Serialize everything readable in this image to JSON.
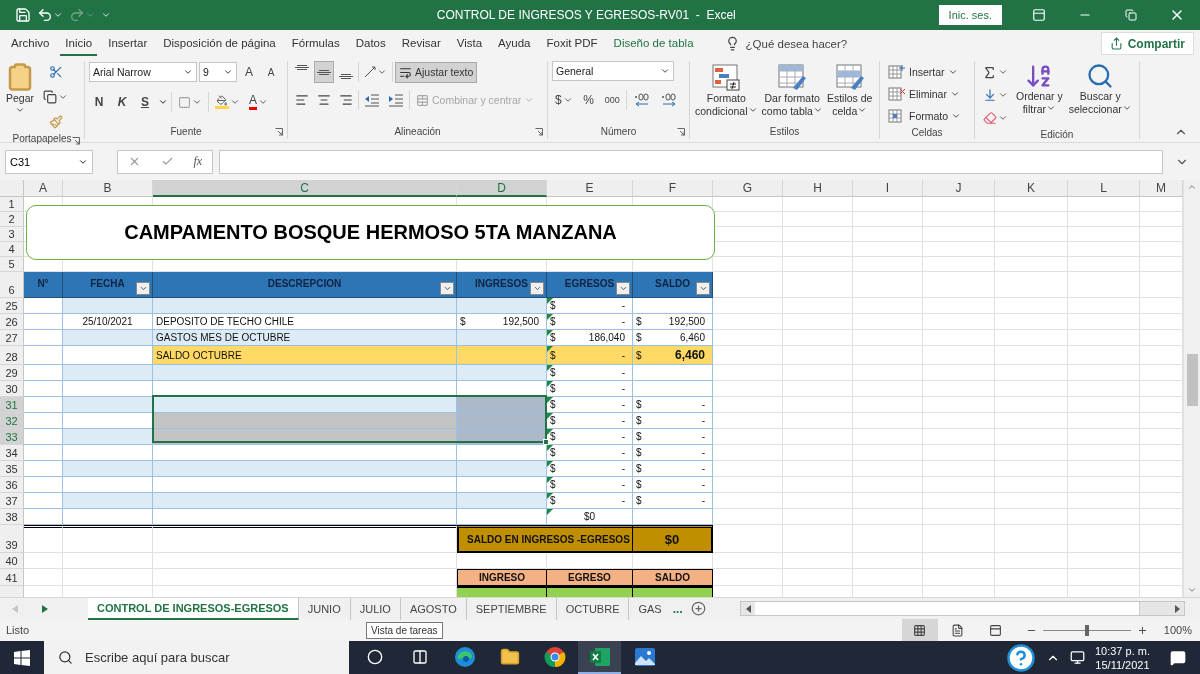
{
  "window": {
    "title": "CONTROL DE INGRESOS Y EGRESOS-RV01  -  Excel",
    "sign_in": "Inic. ses."
  },
  "menu_tabs": [
    {
      "label": "Archivo",
      "selected": false,
      "kind": "normal"
    },
    {
      "label": "Inicio",
      "selected": true,
      "kind": "normal"
    },
    {
      "label": "Insertar",
      "selected": false,
      "kind": "normal"
    },
    {
      "label": "Disposición de página",
      "selected": false,
      "kind": "normal"
    },
    {
      "label": "Fórmulas",
      "selected": false,
      "kind": "normal"
    },
    {
      "label": "Datos",
      "selected": false,
      "kind": "normal"
    },
    {
      "label": "Revisar",
      "selected": false,
      "kind": "normal"
    },
    {
      "label": "Vista",
      "selected": false,
      "kind": "normal"
    },
    {
      "label": "Ayuda",
      "selected": false,
      "kind": "normal"
    },
    {
      "label": "Foxit PDF",
      "selected": false,
      "kind": "normal"
    },
    {
      "label": "Diseño de tabla",
      "selected": false,
      "kind": "contextual"
    }
  ],
  "tell_me": "¿Qué desea hacer?",
  "share": "Compartir",
  "ribbon": {
    "clipboard": {
      "paste": "Pegar",
      "label": "Portapapeles"
    },
    "font": {
      "name": "Arial Narrow",
      "size": "9",
      "grow": "A",
      "shrink": "A",
      "bold": "N",
      "italic": "K",
      "underline": "S",
      "text_color_letter": "A",
      "label": "Fuente"
    },
    "alignment": {
      "valign": [
        {
          "selected": false
        },
        {
          "selected": true
        },
        {
          "selected": false
        }
      ],
      "wrap": {
        "label": "Ajustar texto",
        "on": true
      },
      "merge": {
        "label": "Combinar y centrar",
        "disabled": true
      },
      "label": "Alineación"
    },
    "number": {
      "format": "General",
      "currency": "$",
      "percent": "%",
      "thousands": "000",
      "label": "Número"
    },
    "styles": {
      "buttons": [
        {
          "line1": "Formato",
          "line2": "condicional"
        },
        {
          "line1": "Dar formato",
          "line2": "como tabla"
        },
        {
          "line1": "Estilos de",
          "line2": "celda"
        }
      ],
      "label": "Estilos"
    },
    "cells": {
      "items": [
        "Insertar",
        "Eliminar",
        "Formato"
      ],
      "label": "Celdas"
    },
    "editing": {
      "buttons": [
        {
          "line1": "Ordenar y",
          "line2": "filtrar"
        },
        {
          "line1": "Buscar y",
          "line2": "seleccionar"
        }
      ],
      "label": "Edición"
    }
  },
  "formula_bar": {
    "name_box": "C31",
    "fx": "fx"
  },
  "sheet": {
    "columns": [
      {
        "label": "A",
        "selected": false
      },
      {
        "label": "B",
        "selected": false
      },
      {
        "label": "C",
        "selected": true
      },
      {
        "label": "D",
        "selected": true
      },
      {
        "label": "E",
        "selected": false
      },
      {
        "label": "F",
        "selected": false
      },
      {
        "label": "G",
        "selected": false
      },
      {
        "label": "H",
        "selected": false
      },
      {
        "label": "I",
        "selected": false
      },
      {
        "label": "J",
        "selected": false
      },
      {
        "label": "K",
        "selected": false
      },
      {
        "label": "L",
        "selected": false
      },
      {
        "label": "M",
        "selected": false
      }
    ],
    "top_rows": [
      "1",
      "2",
      "3",
      "4",
      "5"
    ],
    "header_row": "6",
    "title": "CAMPAMENTO BOSQUE HERMOSO 5TA MANZANA"
  },
  "table": {
    "columns": [
      {
        "label": "N°",
        "filter": false
      },
      {
        "label": "FECHA",
        "filter": true
      },
      {
        "label": "DESCREPCION",
        "filter": true
      },
      {
        "label": "INGRESOS",
        "filter": true
      },
      {
        "label": "EGRESOS",
        "filter": true
      },
      {
        "label": "SALDO",
        "filter": true
      }
    ],
    "rows": [
      {
        "row": "25",
        "selected": false,
        "kind": "band",
        "shade_desc": false,
        "shade_ing": false,
        "egresos": {
          "symbol": "$",
          "amount": "-",
          "flag": true
        }
      },
      {
        "row": "26",
        "selected": false,
        "kind": "plain",
        "shade_desc": false,
        "shade_ing": false,
        "fecha": "25/10/2021",
        "descripcion": "DEPOSITO DE TECHO CHILE",
        "ingresos": {
          "symbol": "$",
          "amount": "192,500",
          "flag": false
        },
        "egresos": {
          "symbol": "$",
          "amount": "-",
          "flag": true
        },
        "saldo": {
          "symbol": "$",
          "amount": "192,500",
          "flag": false
        }
      },
      {
        "row": "27",
        "selected": false,
        "kind": "band",
        "shade_desc": false,
        "shade_ing": false,
        "descripcion": "GASTOS MES DE OCTUBRE",
        "egresos": {
          "symbol": "$",
          "amount": "186,040",
          "flag": true
        },
        "saldo": {
          "symbol": "$",
          "amount": "6,460",
          "flag": false
        }
      },
      {
        "row": "28",
        "selected": false,
        "kind": "total",
        "shade_desc": false,
        "shade_ing": false,
        "descripcion": "SALDO OCTUBRE",
        "egresos": {
          "symbol": "$",
          "amount": "-",
          "flag": true
        },
        "saldo": {
          "symbol": "$",
          "amount": "6,460",
          "flag": false,
          "strong": true
        }
      },
      {
        "row": "29",
        "selected": false,
        "kind": "band",
        "shade_desc": false,
        "shade_ing": false,
        "egresos": {
          "symbol": "$",
          "amount": "-",
          "flag": true
        }
      },
      {
        "row": "30",
        "selected": false,
        "kind": "plain",
        "shade_desc": false,
        "shade_ing": false,
        "egresos": {
          "symbol": "$",
          "amount": "-",
          "flag": true
        }
      },
      {
        "row": "31",
        "selected": true,
        "kind": "band",
        "shade_desc": false,
        "shade_ing": true,
        "egresos": {
          "symbol": "$",
          "amount": "-",
          "flag": true
        },
        "saldo": {
          "symbol": "$",
          "amount": "-",
          "flag": false
        }
      },
      {
        "row": "32",
        "selected": true,
        "kind": "plain",
        "shade_desc": true,
        "shade_ing": true,
        "egresos": {
          "symbol": "$",
          "amount": "-",
          "flag": true
        },
        "saldo": {
          "symbol": "$",
          "amount": "-",
          "flag": false
        }
      },
      {
        "row": "33",
        "selected": true,
        "kind": "band",
        "shade_desc": true,
        "shade_ing": true,
        "egresos": {
          "symbol": "$",
          "amount": "-",
          "flag": true
        },
        "saldo": {
          "symbol": "$",
          "amount": "-",
          "flag": false
        }
      },
      {
        "row": "34",
        "selected": false,
        "kind": "plain",
        "shade_desc": false,
        "shade_ing": false,
        "egresos": {
          "symbol": "$",
          "amount": "-",
          "flag": true
        },
        "saldo": {
          "symbol": "$",
          "amount": "-",
          "flag": false
        }
      },
      {
        "row": "35",
        "selected": false,
        "kind": "band",
        "shade_desc": false,
        "shade_ing": false,
        "egresos": {
          "symbol": "$",
          "amount": "-",
          "flag": true
        },
        "saldo": {
          "symbol": "$",
          "amount": "-",
          "flag": false
        }
      },
      {
        "row": "36",
        "selected": false,
        "kind": "plain",
        "shade_desc": false,
        "shade_ing": false,
        "egresos": {
          "symbol": "$",
          "amount": "-",
          "flag": true
        },
        "saldo": {
          "symbol": "$",
          "amount": "-",
          "flag": false
        }
      },
      {
        "row": "37",
        "selected": false,
        "kind": "band",
        "shade_desc": false,
        "shade_ing": false,
        "egresos": {
          "symbol": "$",
          "amount": "-",
          "flag": true
        },
        "saldo": {
          "symbol": "$",
          "amount": "-",
          "flag": false
        }
      },
      {
        "row": "38",
        "selected": false,
        "kind": "plain",
        "shade_desc": false,
        "shade_ing": false,
        "egresos": {
          "amount": "$0",
          "flag": true
        }
      }
    ]
  },
  "summary": {
    "row": "39",
    "label": "SALDO EN INGRESOS -EGRESOS",
    "value": "$0"
  },
  "blank_row": "40",
  "totals_header": {
    "row": "41",
    "labels": [
      "INGRESO",
      "EGRESO",
      "SALDO"
    ]
  },
  "sheet_tabs": [
    {
      "label": "CONTROL DE INGRESOS-EGRESOS",
      "selected": true
    },
    {
      "label": "JUNIO",
      "selected": false
    },
    {
      "label": "JULIO",
      "selected": false
    },
    {
      "label": "AGOSTO",
      "selected": false
    },
    {
      "label": "SEPTIEMBRE",
      "selected": false
    },
    {
      "label": "OCTUBRE",
      "selected": false
    },
    {
      "label": "GAS",
      "selected": false
    }
  ],
  "tab_overflow": "...",
  "status_bar": {
    "status": "Listo",
    "tooltip": "Vista de tareas",
    "views": [
      {
        "selected": true
      },
      {
        "selected": false
      },
      {
        "selected": false
      }
    ],
    "zoom": {
      "level": 0.5
    },
    "zoom_label": "100%"
  },
  "taskbar": {
    "placeholder": "Escribe aquí para buscar",
    "apps": [
      {
        "kind": "cortana",
        "selected": false
      },
      {
        "kind": "taskview",
        "selected": false
      },
      {
        "kind": "edge",
        "selected": false
      },
      {
        "kind": "folder",
        "selected": false
      },
      {
        "kind": "chrome",
        "selected": false
      },
      {
        "kind": "excel",
        "selected": true
      },
      {
        "kind": "photos",
        "selected": false
      }
    ],
    "time": "10:37 p. m.",
    "date": "15/11/2021"
  }
}
